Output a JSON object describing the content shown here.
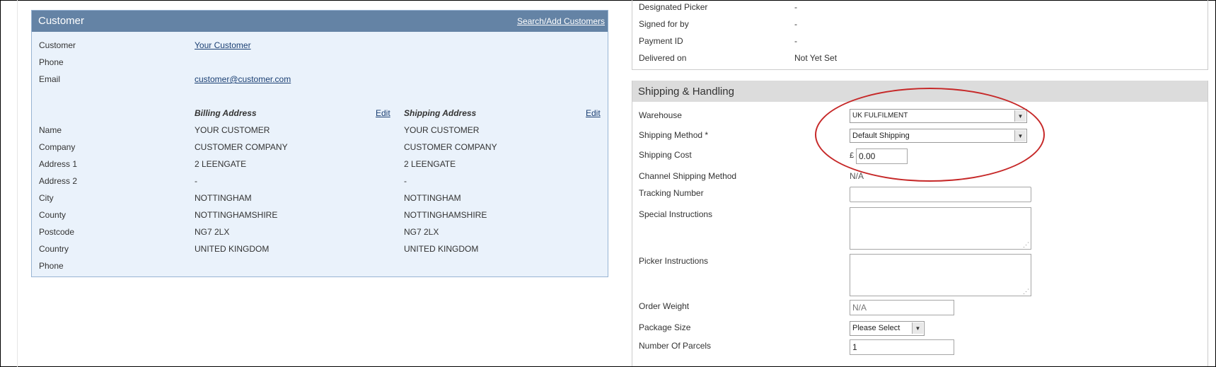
{
  "customer_panel": {
    "title": "Customer",
    "search_link": "Search/Add Customers",
    "customer_label": "Customer",
    "customer_value": "Your Customer",
    "phone_label": "Phone",
    "email_label": "Email",
    "email_value": "customer@customer.com",
    "billing_heading": "Billing Address",
    "shipping_heading": "Shipping Address",
    "edit_label": "Edit",
    "address_rows": [
      {
        "label": "Name",
        "billing": "YOUR CUSTOMER",
        "shipping": "YOUR CUSTOMER"
      },
      {
        "label": "Company",
        "billing": "CUSTOMER COMPANY",
        "shipping": "CUSTOMER COMPANY"
      },
      {
        "label": "Address 1",
        "billing": "2 LEENGATE",
        "shipping": "2 LEENGATE"
      },
      {
        "label": "Address 2",
        "billing": "-",
        "shipping": "-"
      },
      {
        "label": "City",
        "billing": "NOTTINGHAM",
        "shipping": "NOTTINGHAM"
      },
      {
        "label": "County",
        "billing": "NOTTINGHAMSHIRE",
        "shipping": "NOTTINGHAMSHIRE"
      },
      {
        "label": "Postcode",
        "billing": "NG7 2LX",
        "shipping": "NG7 2LX"
      },
      {
        "label": "Country",
        "billing": "UNITED KINGDOM",
        "shipping": "UNITED KINGDOM"
      },
      {
        "label": "Phone",
        "billing": "",
        "shipping": ""
      }
    ]
  },
  "order_details": [
    {
      "label": "Designated Picker",
      "value": "-"
    },
    {
      "label": "Signed for by",
      "value": "-"
    },
    {
      "label": "Payment ID",
      "value": "-"
    },
    {
      "label": "Delivered on",
      "value": "Not Yet Set"
    }
  ],
  "shipping": {
    "title": "Shipping & Handling",
    "warehouse_label": "Warehouse",
    "warehouse_value": "UK FULFILMENT",
    "method_label": "Shipping Method *",
    "method_value": "Default Shipping",
    "cost_label": "Shipping Cost",
    "currency": "£",
    "cost_value": "0.00",
    "channel_label": "Channel Shipping Method",
    "channel_value": "N/A",
    "tracking_label": "Tracking Number",
    "tracking_value": "",
    "special_label": "Special Instructions",
    "picker_label": "Picker Instructions",
    "weight_label": "Order Weight",
    "weight_placeholder": "N/A",
    "package_label": "Package Size",
    "package_value": "Please Select",
    "parcels_label": "Number Of Parcels",
    "parcels_value": "1"
  },
  "highlight_color": "#c62828"
}
